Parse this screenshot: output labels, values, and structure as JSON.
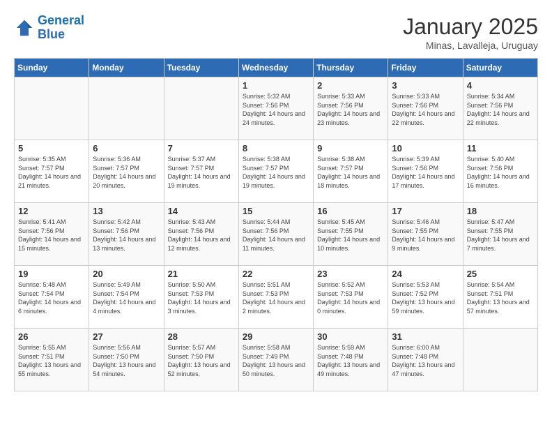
{
  "header": {
    "logo_line1": "General",
    "logo_line2": "Blue",
    "month": "January 2025",
    "location": "Minas, Lavalleja, Uruguay"
  },
  "days_of_week": [
    "Sunday",
    "Monday",
    "Tuesday",
    "Wednesday",
    "Thursday",
    "Friday",
    "Saturday"
  ],
  "weeks": [
    [
      {
        "day": "",
        "content": ""
      },
      {
        "day": "",
        "content": ""
      },
      {
        "day": "",
        "content": ""
      },
      {
        "day": "1",
        "content": "Sunrise: 5:32 AM\nSunset: 7:56 PM\nDaylight: 14 hours and 24 minutes."
      },
      {
        "day": "2",
        "content": "Sunrise: 5:33 AM\nSunset: 7:56 PM\nDaylight: 14 hours and 23 minutes."
      },
      {
        "day": "3",
        "content": "Sunrise: 5:33 AM\nSunset: 7:56 PM\nDaylight: 14 hours and 22 minutes."
      },
      {
        "day": "4",
        "content": "Sunrise: 5:34 AM\nSunset: 7:56 PM\nDaylight: 14 hours and 22 minutes."
      }
    ],
    [
      {
        "day": "5",
        "content": "Sunrise: 5:35 AM\nSunset: 7:57 PM\nDaylight: 14 hours and 21 minutes."
      },
      {
        "day": "6",
        "content": "Sunrise: 5:36 AM\nSunset: 7:57 PM\nDaylight: 14 hours and 20 minutes."
      },
      {
        "day": "7",
        "content": "Sunrise: 5:37 AM\nSunset: 7:57 PM\nDaylight: 14 hours and 19 minutes."
      },
      {
        "day": "8",
        "content": "Sunrise: 5:38 AM\nSunset: 7:57 PM\nDaylight: 14 hours and 19 minutes."
      },
      {
        "day": "9",
        "content": "Sunrise: 5:38 AM\nSunset: 7:57 PM\nDaylight: 14 hours and 18 minutes."
      },
      {
        "day": "10",
        "content": "Sunrise: 5:39 AM\nSunset: 7:56 PM\nDaylight: 14 hours and 17 minutes."
      },
      {
        "day": "11",
        "content": "Sunrise: 5:40 AM\nSunset: 7:56 PM\nDaylight: 14 hours and 16 minutes."
      }
    ],
    [
      {
        "day": "12",
        "content": "Sunrise: 5:41 AM\nSunset: 7:56 PM\nDaylight: 14 hours and 15 minutes."
      },
      {
        "day": "13",
        "content": "Sunrise: 5:42 AM\nSunset: 7:56 PM\nDaylight: 14 hours and 13 minutes."
      },
      {
        "day": "14",
        "content": "Sunrise: 5:43 AM\nSunset: 7:56 PM\nDaylight: 14 hours and 12 minutes."
      },
      {
        "day": "15",
        "content": "Sunrise: 5:44 AM\nSunset: 7:56 PM\nDaylight: 14 hours and 11 minutes."
      },
      {
        "day": "16",
        "content": "Sunrise: 5:45 AM\nSunset: 7:55 PM\nDaylight: 14 hours and 10 minutes."
      },
      {
        "day": "17",
        "content": "Sunrise: 5:46 AM\nSunset: 7:55 PM\nDaylight: 14 hours and 9 minutes."
      },
      {
        "day": "18",
        "content": "Sunrise: 5:47 AM\nSunset: 7:55 PM\nDaylight: 14 hours and 7 minutes."
      }
    ],
    [
      {
        "day": "19",
        "content": "Sunrise: 5:48 AM\nSunset: 7:54 PM\nDaylight: 14 hours and 6 minutes."
      },
      {
        "day": "20",
        "content": "Sunrise: 5:49 AM\nSunset: 7:54 PM\nDaylight: 14 hours and 4 minutes."
      },
      {
        "day": "21",
        "content": "Sunrise: 5:50 AM\nSunset: 7:53 PM\nDaylight: 14 hours and 3 minutes."
      },
      {
        "day": "22",
        "content": "Sunrise: 5:51 AM\nSunset: 7:53 PM\nDaylight: 14 hours and 2 minutes."
      },
      {
        "day": "23",
        "content": "Sunrise: 5:52 AM\nSunset: 7:53 PM\nDaylight: 14 hours and 0 minutes."
      },
      {
        "day": "24",
        "content": "Sunrise: 5:53 AM\nSunset: 7:52 PM\nDaylight: 13 hours and 59 minutes."
      },
      {
        "day": "25",
        "content": "Sunrise: 5:54 AM\nSunset: 7:51 PM\nDaylight: 13 hours and 57 minutes."
      }
    ],
    [
      {
        "day": "26",
        "content": "Sunrise: 5:55 AM\nSunset: 7:51 PM\nDaylight: 13 hours and 55 minutes."
      },
      {
        "day": "27",
        "content": "Sunrise: 5:56 AM\nSunset: 7:50 PM\nDaylight: 13 hours and 54 minutes."
      },
      {
        "day": "28",
        "content": "Sunrise: 5:57 AM\nSunset: 7:50 PM\nDaylight: 13 hours and 52 minutes."
      },
      {
        "day": "29",
        "content": "Sunrise: 5:58 AM\nSunset: 7:49 PM\nDaylight: 13 hours and 50 minutes."
      },
      {
        "day": "30",
        "content": "Sunrise: 5:59 AM\nSunset: 7:48 PM\nDaylight: 13 hours and 49 minutes."
      },
      {
        "day": "31",
        "content": "Sunrise: 6:00 AM\nSunset: 7:48 PM\nDaylight: 13 hours and 47 minutes."
      },
      {
        "day": "",
        "content": ""
      }
    ]
  ]
}
